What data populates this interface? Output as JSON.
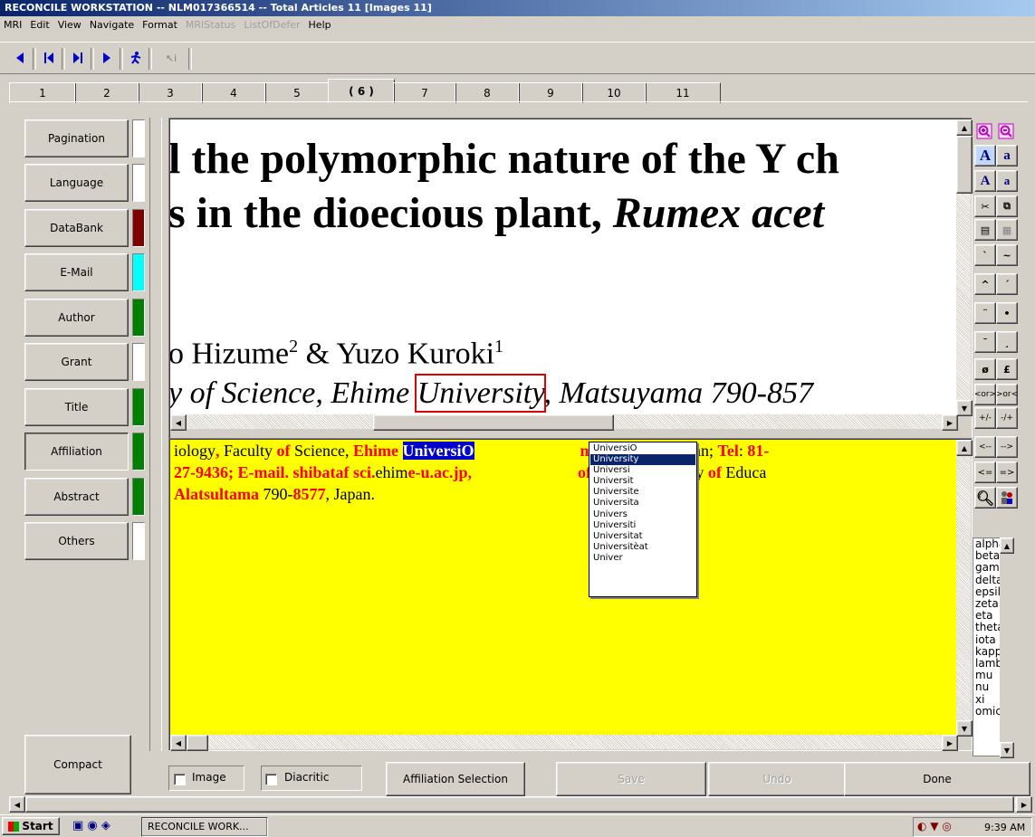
{
  "window": {
    "title": "RECONCILE WORKSTATION -- NLM017366514 -- Total Articles 11 [Images 11]"
  },
  "menu": [
    "MRI",
    "Edit",
    "View",
    "Navigate",
    "Format",
    "MRIStatus",
    "ListOfDefer",
    "Help"
  ],
  "menu_disabled": [
    "MRIStatus",
    "ListOfDefer"
  ],
  "toolbar": {
    "icons": [
      "prev-arrow-icon",
      "first-icon",
      "last-icon",
      "next-arrow-icon",
      "runner-icon",
      "pointer-info-icon"
    ]
  },
  "tabs": {
    "labels": [
      "1",
      "2",
      "3",
      "4",
      "5",
      "( 6 )",
      "7",
      "8",
      "9",
      "10",
      "11"
    ],
    "active": "( 6 )"
  },
  "left_buttons": [
    {
      "label": "Pagination",
      "indicator": "#ffffff"
    },
    {
      "label": "Language",
      "indicator": "#ffffff"
    },
    {
      "label": "DataBank",
      "indicator": "#800000"
    },
    {
      "label": "E-Mail",
      "indicator": "#00ffff"
    },
    {
      "label": "Author",
      "indicator": "#008000"
    },
    {
      "label": "Grant",
      "indicator": "#ffffff"
    },
    {
      "label": "Title",
      "indicator": "#008000"
    },
    {
      "label": "Affiliation",
      "indicator": "#008000"
    },
    {
      "label": "Abstract",
      "indicator": "#008000"
    },
    {
      "label": "Others",
      "indicator": "#ffffff"
    }
  ],
  "compact_label": "Compact",
  "image_pane": {
    "line1": "l the polymorphic nature of the Y ch",
    "line2_a": "s in the dioecious plant, ",
    "line2_b": "Rumex acet",
    "authors_a": "o Hizume",
    "authors_sup1": "2",
    "authors_b": " & Yuzo Kuroki",
    "authors_sup2": "1",
    "aff_a": "y of Science, Ehime ",
    "aff_boxed": "University",
    "aff_b": ", Matsuyama 790-857"
  },
  "text_pane": {
    "l1": [
      {
        "t": "iology",
        "s": "n"
      },
      {
        "t": ",",
        "s": "r"
      },
      {
        "t": " Faculty ",
        "s": "n"
      },
      {
        "t": "of",
        "s": "r"
      },
      {
        "t": " Science, ",
        "s": "n"
      },
      {
        "t": "Ehime ",
        "s": "r"
      },
      {
        "t": "UniversiO",
        "s": "sel"
      },
      {
        "t": "                          ",
        "s": "n"
      },
      {
        "t": "na",
        "s": "r"
      },
      {
        "t": " 790-",
        "s": "n"
      },
      {
        "t": "8577",
        "s": "r"
      },
      {
        "t": ", Japan; ",
        "s": "n"
      },
      {
        "t": "Tel",
        "s": "r"
      },
      {
        "t": ": ",
        "s": "n"
      },
      {
        "t": "81-",
        "s": "r"
      }
    ],
    "l2": [
      {
        "t": "27-9436; E-mail. shibataf sci.",
        "s": "r"
      },
      {
        "t": "ehim",
        "s": "n"
      },
      {
        "t": "e-u.ac.jp,",
        "s": "r"
      },
      {
        "t": "                          ",
        "s": "n"
      },
      {
        "t": "of",
        "s": "r"
      },
      {
        "t": " Biology, Faculty ",
        "s": "n"
      },
      {
        "t": "of",
        "s": "r"
      },
      {
        "t": " Educa",
        "s": "n"
      }
    ],
    "l3": [
      {
        "t": "Alatsultama",
        "s": "r"
      },
      {
        "t": " 790-",
        "s": "n"
      },
      {
        "t": "8577",
        "s": "r"
      },
      {
        "t": ", Japan.",
        "s": "n"
      }
    ]
  },
  "suggestions": [
    "UniversiO",
    "University",
    "Universi",
    "Universit",
    "Universite",
    "Universita",
    "Univers",
    "Universiti",
    "Universitat",
    "Universitèat",
    "Univer"
  ],
  "suggestion_highlighted": "University",
  "palette": {
    "row3": [
      "ṡ",
      "ṥ"
    ],
    "keys": [
      "`",
      "~",
      "^",
      "´",
      "¨",
      "•",
      "¯",
      "¸",
      "ø",
      "£",
      "<or>",
      ">or<",
      "+/-",
      "-/+",
      "<--",
      "-->",
      "<=",
      "=>"
    ]
  },
  "greek": [
    "alpha",
    "beta",
    "gamma",
    "delta",
    "epsilon",
    "zeta",
    "eta",
    "theta",
    "iota",
    "kappa",
    "lambda",
    "mu",
    "nu",
    "xi",
    "omicron"
  ],
  "bottom": {
    "image_label": "Image",
    "diacritic_label": "Diacritic",
    "affiliation_selection": "Affiliation Selection",
    "save": "Save",
    "undo": "Undo",
    "done": "Done"
  },
  "taskbar": {
    "start": "Start",
    "task": "RECONCILE WORK...",
    "clock": "9:39 AM"
  }
}
